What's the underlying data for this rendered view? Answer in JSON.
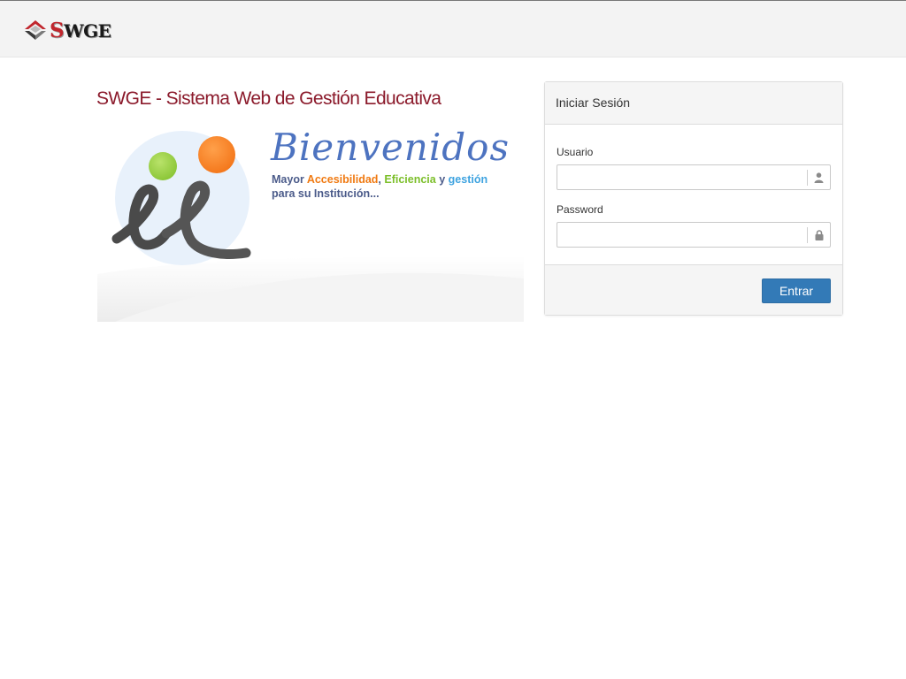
{
  "brand": {
    "logo_text_first": "S",
    "logo_text_rest": "WGE"
  },
  "page": {
    "title": "SWGE - Sistema Web de Gestión Educativa"
  },
  "welcome_banner": {
    "heading": "Bienvenidos",
    "tagline": {
      "word1": "Mayor ",
      "word2": "Accesibilidad",
      "sep1": ", ",
      "word3": "Eficiencia",
      "sep2": " y ",
      "word4": "gestión",
      "line2": "para su Institución..."
    }
  },
  "login_panel": {
    "heading": "Iniciar Sesión",
    "username": {
      "label": "Usuario",
      "value": "",
      "placeholder": ""
    },
    "password": {
      "label": "Password",
      "value": "",
      "placeholder": ""
    },
    "submit_label": "Entrar"
  },
  "colors": {
    "accent": "#337ab7",
    "title": "#8b1a2b",
    "brand_red": "#c0262d",
    "heading_blue": "#4d73c0"
  },
  "icons": {
    "username_addon": "user-icon",
    "password_addon": "lock-icon"
  }
}
